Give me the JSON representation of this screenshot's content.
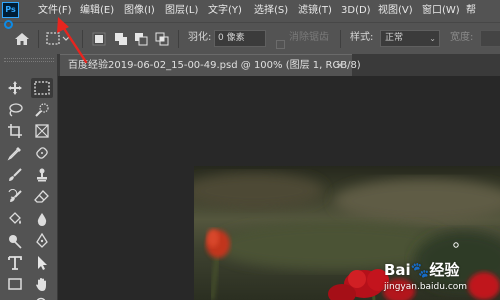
{
  "app": {
    "logo": "Ps"
  },
  "menu": {
    "items": [
      "文件(F)",
      "编辑(E)",
      "图像(I)",
      "图层(L)",
      "文字(Y)",
      "选择(S)",
      "滤镜(T)",
      "3D(D)",
      "视图(V)",
      "窗口(W)",
      "帮"
    ]
  },
  "options": {
    "feather_label": "羽化:",
    "feather_value": "0 像素",
    "antialias_label": "消除锯齿",
    "style_label": "样式:",
    "style_value": "正常",
    "width_label": "宽度:"
  },
  "document": {
    "tab_title": "百度经验2019-06-02_15-00-49.psd @ 100% (图层 1, RGB/8)",
    "close": "×"
  },
  "watermark": {
    "logo_text": "Bai🐾经验",
    "url": "jingyan.baidu.com"
  },
  "colors": {
    "menubar": "#535353",
    "workspace": "#282828",
    "annotation_arrow": "#e8251f",
    "cursor": "#0d8be6"
  },
  "icons": {
    "home": "home-icon",
    "marquee": "rect-marquee-icon"
  }
}
